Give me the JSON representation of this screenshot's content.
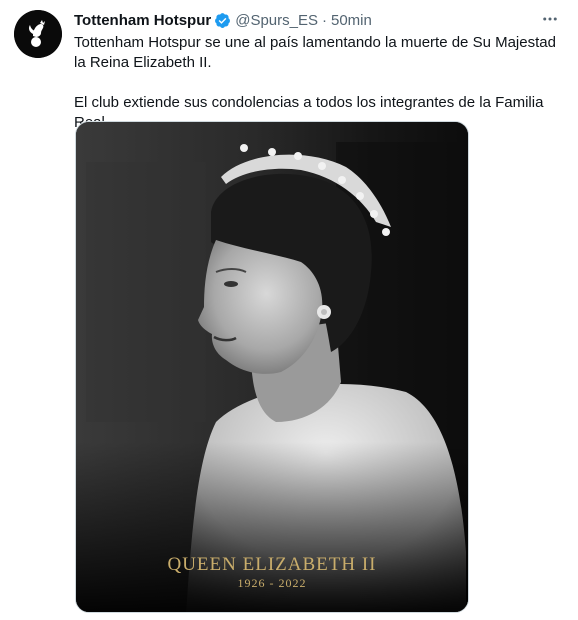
{
  "tweet": {
    "display_name": "Tottenham Hotspur",
    "handle": "@Spurs_ES",
    "separator": "·",
    "time": "50min",
    "more_icon": "more-horizontal-icon",
    "verified_icon": "verified-badge-icon",
    "text": [
      "Tottenham Hotspur se une al país lamentando la muerte de Su Majestad la Reina Elizabeth II.",
      "El club extiende sus condolencias a todos los integrantes de la Familia Real."
    ],
    "media": {
      "caption_title": "QUEEN ELIZABETH II",
      "caption_years": "1926 - 2022"
    }
  },
  "colors": {
    "verified": "#1d9bf0",
    "secondary_text": "#536471",
    "caption_gold": "#c9ad6b"
  }
}
